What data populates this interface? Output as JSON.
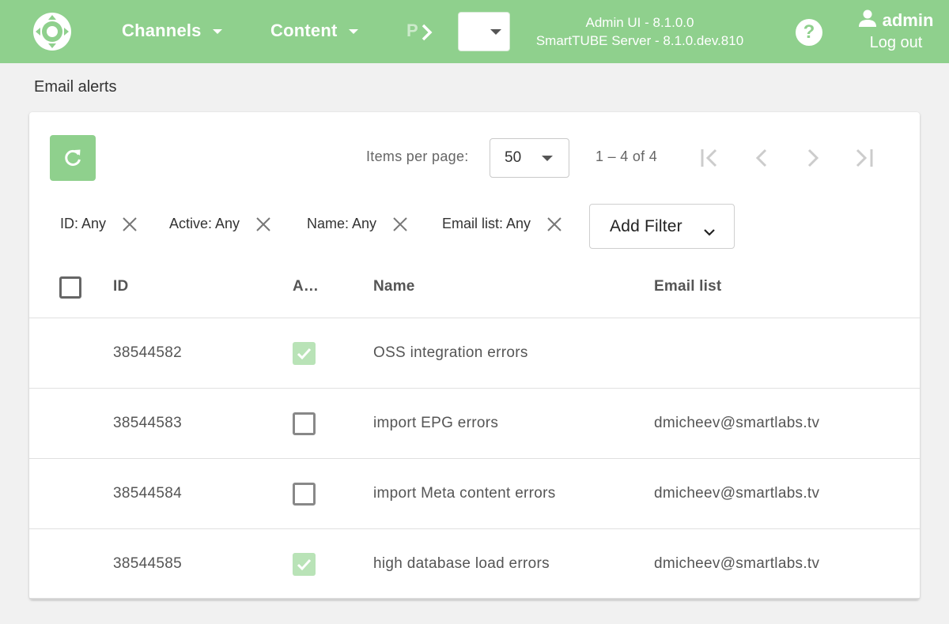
{
  "header": {
    "logo_icon": "dpad-logo-icon",
    "nav": [
      {
        "label": "Channels"
      },
      {
        "label": "Content"
      }
    ],
    "nav_truncated": "P",
    "version_line1": "Admin UI - 8.1.0.0",
    "version_line2": "SmartTUBE Server - 8.1.0.dev.810",
    "help_glyph": "?",
    "user_name": "admin",
    "logout_label": "Log out",
    "bg_color": "#8fd08d"
  },
  "page": {
    "title": "Email alerts"
  },
  "toolbar": {
    "refresh_icon": "refresh-icon",
    "items_per_page_label": "Items per page:",
    "items_per_page_value": "50",
    "range_label": "1 – 4 of 4"
  },
  "filters": [
    {
      "label": "ID: Any"
    },
    {
      "label": "Active: Any"
    },
    {
      "label": "Name: Any"
    },
    {
      "label": "Email list: Any"
    }
  ],
  "add_filter_label": "Add Filter",
  "table": {
    "columns": {
      "id": "ID",
      "active": "A…",
      "name": "Name",
      "email": "Email list"
    },
    "rows": [
      {
        "id": "38544582",
        "active": true,
        "name": "OSS integration errors",
        "email": ""
      },
      {
        "id": "38544583",
        "active": false,
        "name": "import EPG errors",
        "email": "dmicheev@smartlabs.tv"
      },
      {
        "id": "38544584",
        "active": false,
        "name": "import Meta content errors",
        "email": "dmicheev@smartlabs.tv"
      },
      {
        "id": "38544585",
        "active": true,
        "name": "high database load errors",
        "email": "dmicheev@smartlabs.tv"
      }
    ]
  }
}
